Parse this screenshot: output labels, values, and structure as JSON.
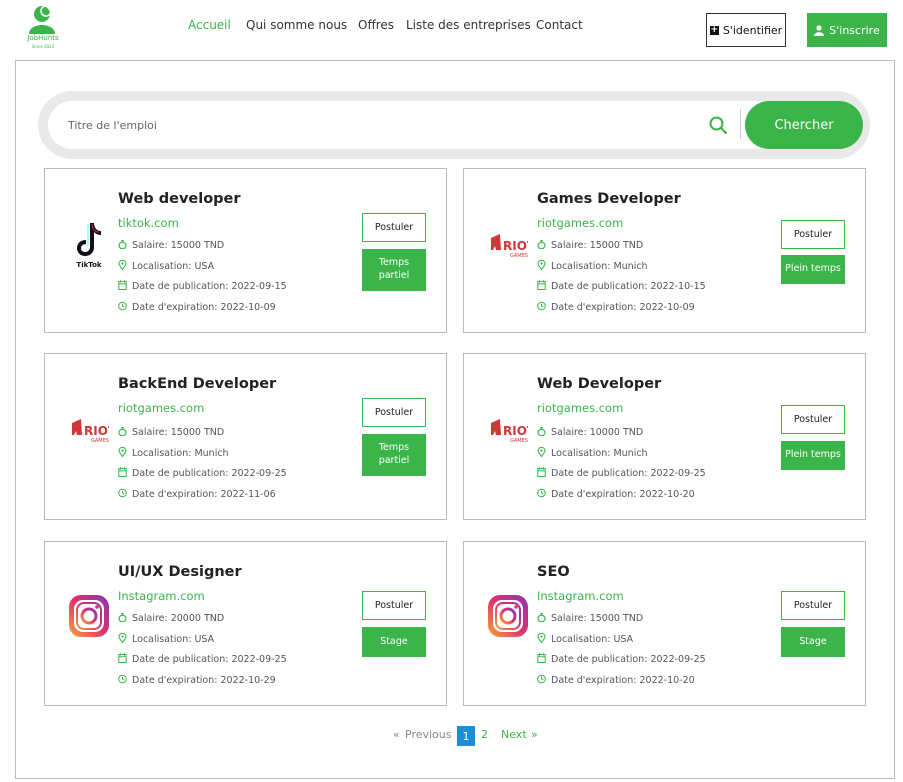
{
  "header": {
    "logo_text": "JobHunts",
    "logo_sub": "Since 2022",
    "nav": [
      "Accueil",
      "Qui somme nous",
      "Offres",
      "Liste des entreprises",
      "Contact"
    ],
    "login_label": "S'identifier",
    "signup_label": "S'inscrire"
  },
  "search": {
    "placeholder": "Titre de l'emploi",
    "button_label": "Chercher"
  },
  "labels": {
    "salary": "Salaire:",
    "location": "Localisation:",
    "published": "Date de publication:",
    "expiration": "Date d'expiration:",
    "apply": "Postuler"
  },
  "jobs": [
    {
      "title": "Web developer",
      "company": "tiktok.com",
      "logo": "tiktok-logo",
      "salary": "15000 TND",
      "location": "USA",
      "published": "2022-09-15",
      "expiration": "2022-10-09",
      "type": "Temps partiel"
    },
    {
      "title": "Games Developer",
      "company": "riotgames.com",
      "logo": "riot-logo",
      "salary": "15000 TND",
      "location": "Munich",
      "published": "2022-10-15",
      "expiration": "2022-10-09",
      "type": "Plein temps"
    },
    {
      "title": "BackEnd Developer",
      "company": "riotgames.com",
      "logo": "riot-logo",
      "salary": "15000 TND",
      "location": "Munich",
      "published": "2022-09-25",
      "expiration": "2022-11-06",
      "type": "Temps partiel"
    },
    {
      "title": "Web Developer",
      "company": "riotgames.com",
      "logo": "riot-logo",
      "salary": "10000 TND",
      "location": "Munich",
      "published": "2022-09-25",
      "expiration": "2022-10-20",
      "type": "Plein temps"
    },
    {
      "title": "UI/UX Designer",
      "company": "Instagram.com",
      "logo": "instagram-logo",
      "salary": "20000 TND",
      "location": "USA",
      "published": "2022-09-25",
      "expiration": "2022-10-29",
      "type": "Stage"
    },
    {
      "title": "SEO",
      "company": "Instagram.com",
      "logo": "instagram-logo",
      "salary": "15000 TND",
      "location": "USA",
      "published": "2022-09-25",
      "expiration": "2022-10-20",
      "type": "Stage"
    }
  ],
  "pagination": {
    "prev_arrow": "«",
    "prev": "Previous",
    "pages": [
      "1",
      "2"
    ],
    "current": "1",
    "next": "Next",
    "next_arrow": "»"
  },
  "colors": {
    "accent": "#3bb54a",
    "page_active": "#1a8fd6"
  }
}
